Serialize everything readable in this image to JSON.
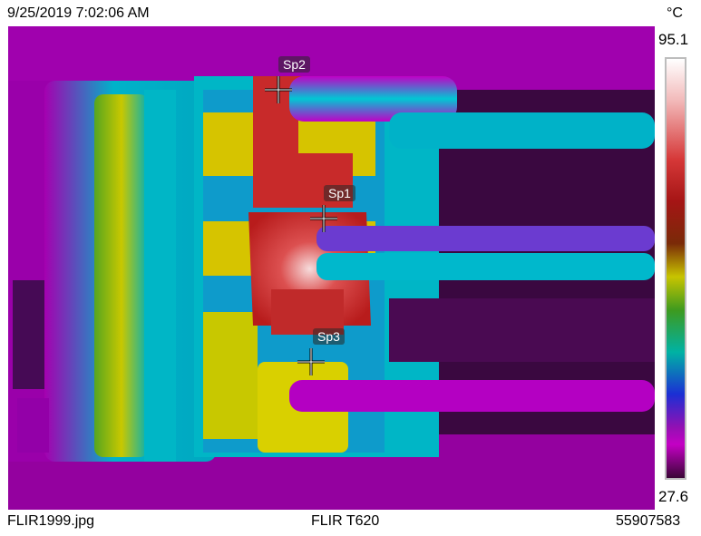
{
  "header": {
    "timestamp": "9/25/2019 7:02:06 AM",
    "unit": "°C"
  },
  "scale": {
    "max": "95.1",
    "min": "27.6"
  },
  "markers": [
    {
      "label": "Sp2"
    },
    {
      "label": "Sp1"
    },
    {
      "label": "Sp3"
    }
  ],
  "footer": {
    "filename": "FLIR1999.jpg",
    "camera": "FLIR T620",
    "serial": "55907583"
  },
  "palette": {
    "background": "#2a0630",
    "magenta": "#c400c4",
    "cyan": "#00bcd4",
    "yellow": "#d9c400",
    "red": "#c92b2b"
  }
}
